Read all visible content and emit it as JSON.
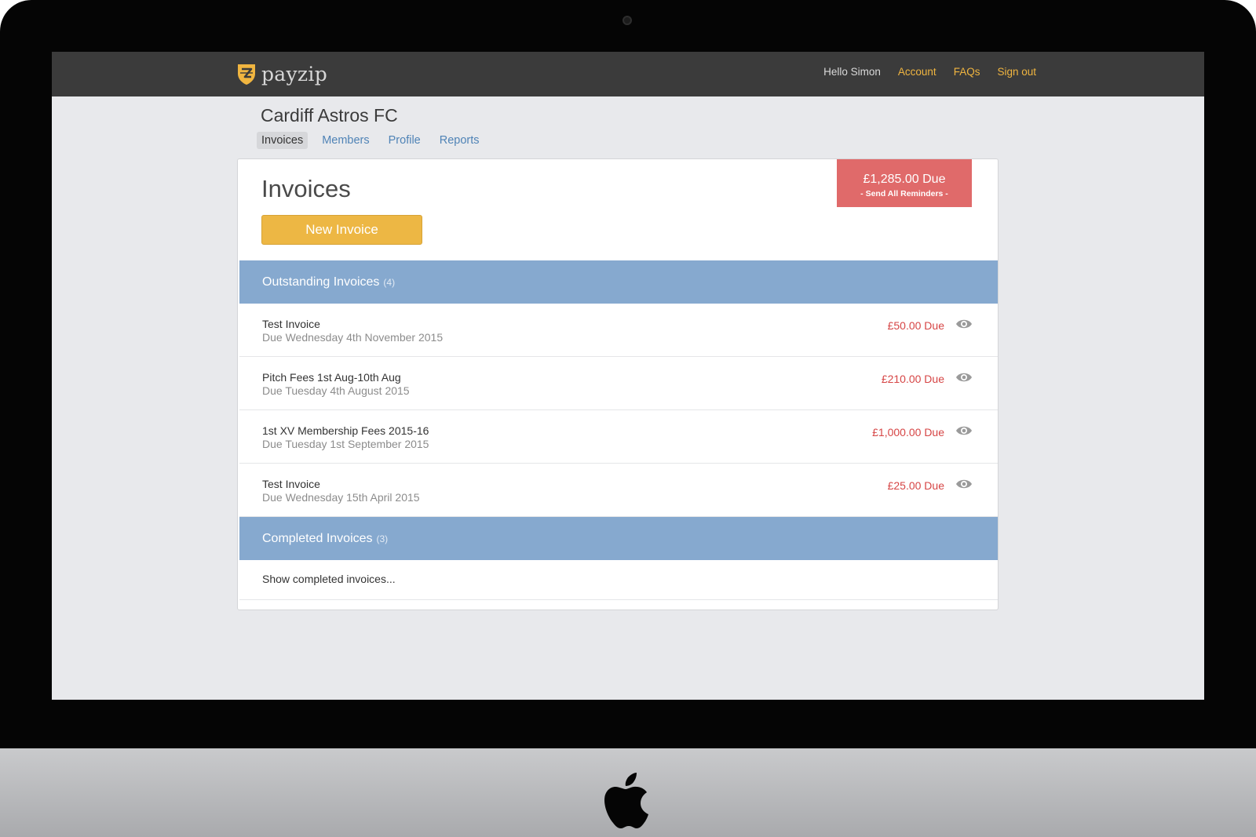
{
  "topbar": {
    "brand": "payzip",
    "greeting": "Hello Simon",
    "links": [
      "Account",
      "FAQs",
      "Sign out"
    ]
  },
  "organisation": {
    "name": "Cardiff Astros FC",
    "tabs": [
      "Invoices",
      "Members",
      "Profile",
      "Reports"
    ],
    "active_tab": "Invoices"
  },
  "invoices": {
    "title": "Invoices",
    "new_button": "New Invoice",
    "total_due": "£1,285.00 Due",
    "send_reminders": "- Send All Reminders -",
    "outstanding": {
      "label": "Outstanding Invoices",
      "count": "(4)",
      "items": [
        {
          "name": "Test Invoice",
          "due": "Due Wednesday 4th November 2015",
          "amount": "£50.00 Due"
        },
        {
          "name": "Pitch Fees 1st Aug-10th Aug",
          "due": "Due Tuesday 4th August 2015",
          "amount": "£210.00 Due"
        },
        {
          "name": "1st XV Membership Fees 2015-16",
          "due": "Due Tuesday 1st September 2015",
          "amount": "£1,000.00 Due"
        },
        {
          "name": "Test Invoice",
          "due": "Due Wednesday 15th April 2015",
          "amount": "£25.00 Due"
        }
      ]
    },
    "completed": {
      "label": "Completed Invoices",
      "count": "(3)",
      "show_link": "Show completed invoices..."
    }
  },
  "colors": {
    "accent_yellow": "#edb744",
    "due_red": "#e06a6a",
    "section_blue": "#86a9cf",
    "link_blue": "#4f83b6",
    "topbar": "#3b3b3b"
  },
  "icons": [
    "payzip-shield-icon",
    "eye-icon",
    "apple-logo-icon",
    "camera-icon"
  ]
}
